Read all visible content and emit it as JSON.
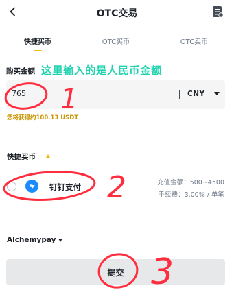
{
  "header": {
    "title": "OTC交易",
    "back_icon": "chevron-left-icon",
    "right_icon": "document-list-icon"
  },
  "tabs": [
    {
      "label": "快捷买币",
      "active": true
    },
    {
      "label": "OTC买币",
      "active": false
    },
    {
      "label": "OTC卖币",
      "active": false
    }
  ],
  "amount": {
    "label": "购买金额",
    "value": "765",
    "currency": "CNY",
    "receive_hint": "您将获得约100.13 USDT"
  },
  "annotations": {
    "text": "这里输入的是人民币金额",
    "marks": [
      "1",
      "2",
      "3"
    ],
    "color": "#ff2d3d",
    "text_color": "#22d3b0"
  },
  "quick_buy": {
    "label": "快捷买币",
    "payment_name": "钉钉支付",
    "payment_icon": "dingtalk-icon",
    "limit": "充值金额：500~4500",
    "fee": "手续费：3.00% / 单笔"
  },
  "provider": {
    "label": "Alchemypay"
  },
  "submit": {
    "label": "提交"
  },
  "colors": {
    "accent": "#f0b90b",
    "hint": "#c99400",
    "dingtalk": "#1a8cff"
  }
}
